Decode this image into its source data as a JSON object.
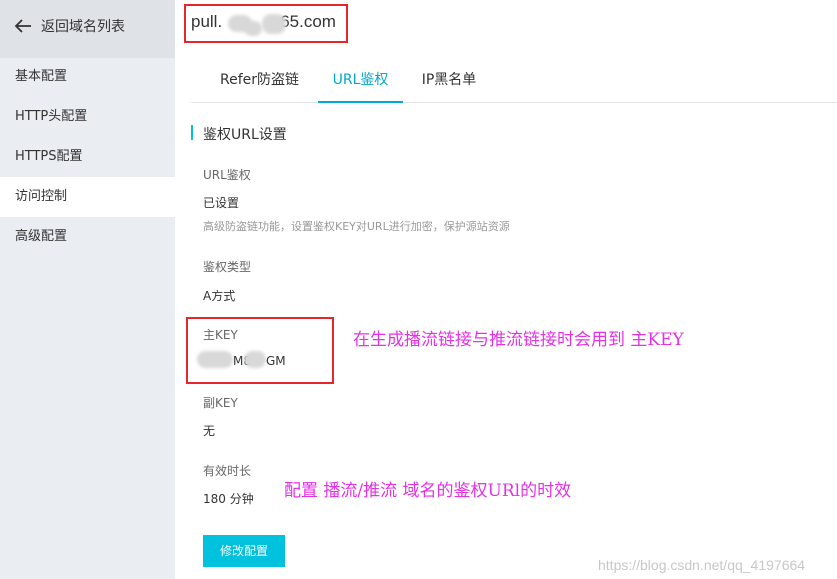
{
  "sidebar": {
    "back_label": "返回域名列表",
    "items": [
      {
        "label": "基本配置"
      },
      {
        "label": "HTTP头配置"
      },
      {
        "label": "HTTPS配置"
      },
      {
        "label": "访问控制"
      },
      {
        "label": "高级配置"
      }
    ]
  },
  "header": {
    "domain_prefix": "pull.",
    "domain_suffix": "65.com"
  },
  "tabs": [
    {
      "label": "Refer防盗链"
    },
    {
      "label": "URL鉴权"
    },
    {
      "label": "IP黑名单"
    }
  ],
  "section": {
    "title": "鉴权URL设置",
    "url_auth_label": "URL鉴权",
    "url_auth_value": "已设置",
    "url_auth_hint": "高级防盗链功能，设置鉴权KEY对URL进行加密，保护源站资源",
    "auth_type_label": "鉴权类型",
    "auth_type_value": "A方式",
    "main_key_label": "主KEY",
    "main_key_visible_1": "M8",
    "main_key_visible_2": "GM",
    "backup_key_label": "副KEY",
    "backup_key_value": "无",
    "validity_label": "有效时长",
    "validity_value": "180 分钟",
    "modify_button": "修改配置"
  },
  "annotations": {
    "key_note": "在生成播流链接与推流链接时会用到 主KEY",
    "validity_note": "配置 播流/推流 域名的鉴权URl的时效"
  },
  "watermark": "https://blog.csdn.net/qq_4197664",
  "colors": {
    "accent": "#00c1de",
    "annotation": "#e632e6",
    "highlight_box": "#e5262d",
    "sidebar_bg": "#eaedf1"
  }
}
